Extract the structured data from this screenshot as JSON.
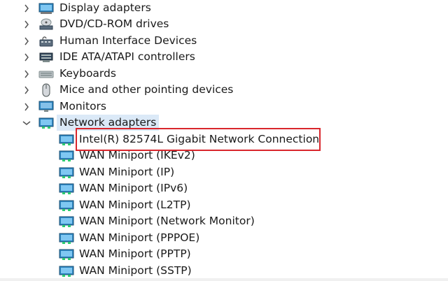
{
  "categories": [
    {
      "label": "Display adapters",
      "icon": "display-adapter-icon"
    },
    {
      "label": "DVD/CD-ROM drives",
      "icon": "dvd-drive-icon"
    },
    {
      "label": "Human Interface Devices",
      "icon": "hid-icon"
    },
    {
      "label": "IDE ATA/ATAPI controllers",
      "icon": "ide-controller-icon"
    },
    {
      "label": "Keyboards",
      "icon": "keyboard-icon"
    },
    {
      "label": "Mice and other pointing devices",
      "icon": "mouse-icon"
    },
    {
      "label": "Monitors",
      "icon": "monitor-icon"
    },
    {
      "label": "Network adapters",
      "icon": "network-adapter-icon",
      "expanded": true
    }
  ],
  "network_adapters": [
    "Intel(R) 82574L Gigabit Network Connection",
    "WAN Miniport (IKEv2)",
    "WAN Miniport (IP)",
    "WAN Miniport (IPv6)",
    "WAN Miniport (L2TP)",
    "WAN Miniport (Network Monitor)",
    "WAN Miniport (PPPOE)",
    "WAN Miniport (PPTP)",
    "WAN Miniport (SSTP)"
  ],
  "colors": {
    "highlight_border": "#d9262c",
    "selection_bg": "#dbe9f7"
  }
}
